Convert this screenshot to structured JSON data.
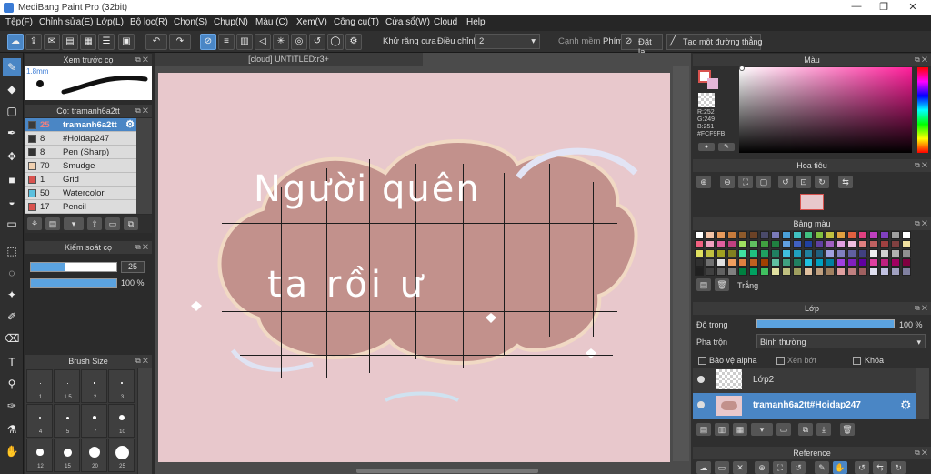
{
  "window": {
    "title": "MediBang Paint Pro (32bit)",
    "minimize": "—",
    "maximize": "❐",
    "close": "✕"
  },
  "menu": [
    "Tệp(F)",
    "Chỉnh sửa(E)",
    "Lớp(L)",
    "Bộ lọc(R)",
    "Chọn(S)",
    "Chụp(N)",
    "Màu (C)",
    "Xem(V)",
    "Công cụ(T)",
    "Cửa sổ(W)",
    "Cloud",
    "Help"
  ],
  "toolbar": {
    "antialias_label": "Khử răng cưa",
    "adjust_label": "Điều chỉnh",
    "adjust_value": "2",
    "edge_label": "Cạnh mềm",
    "key_label": "Phím",
    "reset_label": "Đặt lại",
    "straight_label": "Tạo một đường thẳng"
  },
  "document": {
    "tab": "[cloud] UNTITLED:r3+"
  },
  "brush_preview": {
    "title": "Xem trước cọ",
    "size_label": "1.8mm"
  },
  "brush_panel": {
    "title": "Cọ: tramanh6a2tt",
    "items": [
      {
        "num": "25",
        "name": "tramanh6a2tt",
        "color": "#3a3a3a",
        "selected": true
      },
      {
        "num": "8",
        "name": "#Hoidap247",
        "color": "#333333"
      },
      {
        "num": "8",
        "name": "Pen (Sharp)",
        "color": "#333333"
      },
      {
        "num": "70",
        "name": "Smudge",
        "color": "#f0d0b0"
      },
      {
        "num": "1",
        "name": "Grid",
        "color": "#d9534f"
      },
      {
        "num": "50",
        "name": "Watercolor",
        "color": "#5bc0de"
      },
      {
        "num": "17",
        "name": "Pencil",
        "color": "#d9534f"
      }
    ]
  },
  "brush_control": {
    "title": "Kiểm soát cọ",
    "size_value": "25",
    "opacity_value": "100 %",
    "size_fraction": 0.4,
    "opacity_fraction": 1.0
  },
  "brush_size": {
    "title": "Brush Size",
    "labels": [
      "1",
      "1.5",
      "2",
      "3",
      "4",
      "5",
      "7",
      "10",
      "12",
      "15",
      "20",
      "25"
    ]
  },
  "color_panel": {
    "title": "Màu",
    "r": "R:252",
    "g": "G:249",
    "b": "B:251",
    "hex": "#FCF9FB"
  },
  "navigator": {
    "title": "Hoa tiêu"
  },
  "palette": {
    "title": "Bảng màu",
    "name": "Trắng"
  },
  "layer_panel": {
    "title": "Lớp",
    "opacity_label": "Độ trong",
    "opacity_value": "100 %",
    "blend_label": "Pha trộn",
    "blend_value": "Bình thường",
    "protect_alpha": "Bảo vệ alpha",
    "clip": "Xén bớt",
    "lock": "Khóa",
    "layers": [
      {
        "name": "Lớp2",
        "selected": false
      },
      {
        "name": "tramanh6a2tt#Hoidap247",
        "selected": true
      }
    ]
  },
  "reference": {
    "title": "Reference"
  },
  "artwork": {
    "line1": "Người quên",
    "line2": "ta rồi ư"
  }
}
